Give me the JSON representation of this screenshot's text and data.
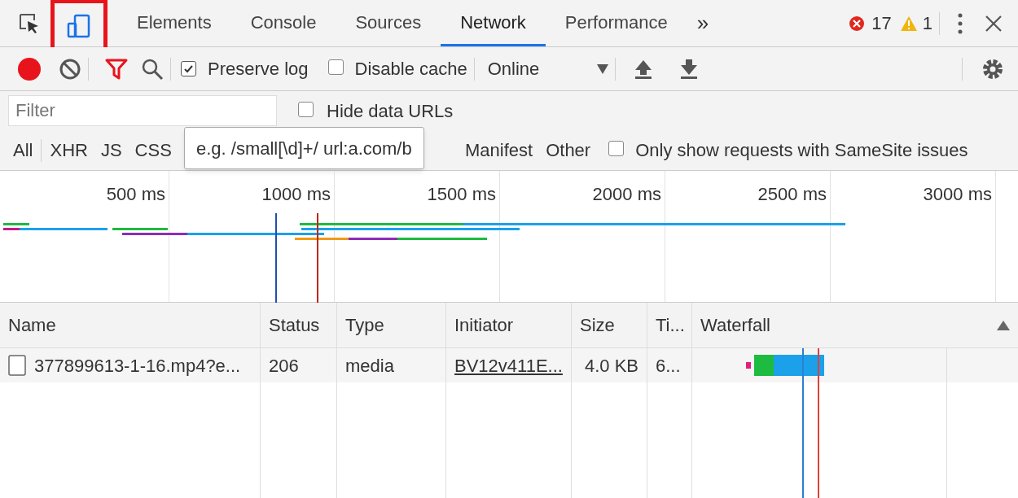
{
  "tabs": [
    {
      "label": "Elements",
      "selected": false
    },
    {
      "label": "Console",
      "selected": false
    },
    {
      "label": "Sources",
      "selected": false
    },
    {
      "label": "Network",
      "selected": true
    },
    {
      "label": "Performance",
      "selected": false
    }
  ],
  "more_tabs": "»",
  "errors": "17",
  "warnings": "1",
  "toolbar": {
    "recording": true,
    "filter_active": true,
    "preserve_log": {
      "label": "Preserve log",
      "checked": true
    },
    "disable_cache": {
      "label": "Disable cache",
      "checked": false
    },
    "throttle": "Online"
  },
  "filter": {
    "placeholder": "Filter",
    "hide_data_urls": {
      "label": "Hide data URLs",
      "checked": false
    }
  },
  "type_filters": [
    "All",
    "XHR",
    "JS",
    "CSS",
    "Manifest",
    "Other"
  ],
  "samesite": {
    "label": "Only show requests with SameSite issues",
    "checked": false
  },
  "tooltip": "e.g. /small[\\d]+/ url:a.com/b",
  "overview_ticks": [
    "500 ms",
    "1000 ms",
    "1500 ms",
    "2000 ms",
    "2500 ms",
    "3000 ms"
  ],
  "table": {
    "columns": [
      "Name",
      "Status",
      "Type",
      "Initiator",
      "Size",
      "Ti...",
      "Waterfall"
    ],
    "rows": [
      {
        "name": "377899613-1-16.mp4?e...",
        "status": "206",
        "type": "media",
        "initiator": "BV12v411E...",
        "size": "4.0 KB",
        "time": "6..."
      }
    ]
  }
}
